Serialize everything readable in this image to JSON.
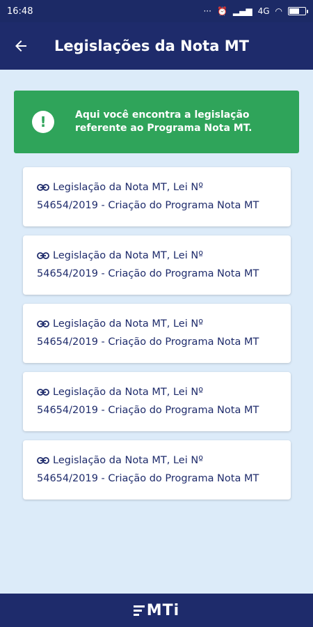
{
  "status_bar": {
    "time": "16:48",
    "network": "4G"
  },
  "header": {
    "title": "Legislações da Nota MT"
  },
  "banner": {
    "line1": "Aqui você encontra a legislação",
    "line2": "referente ao Programa Nota MT."
  },
  "items": [
    {
      "line1": "Legislação da Nota MT, Lei Nº",
      "line2": "54654/2019 - Criação do Programa Nota MT"
    },
    {
      "line1": "Legislação da Nota MT, Lei Nº",
      "line2": "54654/2019 - Criação do Programa Nota MT"
    },
    {
      "line1": "Legislação da Nota MT, Lei Nº",
      "line2": "54654/2019 - Criação do Programa Nota MT"
    },
    {
      "line1": "Legislação da Nota MT, Lei Nº",
      "line2": "54654/2019 - Criação do Programa Nota MT"
    },
    {
      "line1": "Legislação da Nota MT, Lei Nº",
      "line2": "54654/2019 - Criação do Programa Nota MT"
    }
  ],
  "footer": {
    "logo_text": "MTi"
  },
  "colors": {
    "primary": "#1e2b6b",
    "success": "#2fa45a",
    "background": "#dcebf9"
  },
  "icons": {
    "back": "arrow-left-icon",
    "banner": "exclamation-circle-icon",
    "item": "link-icon"
  }
}
